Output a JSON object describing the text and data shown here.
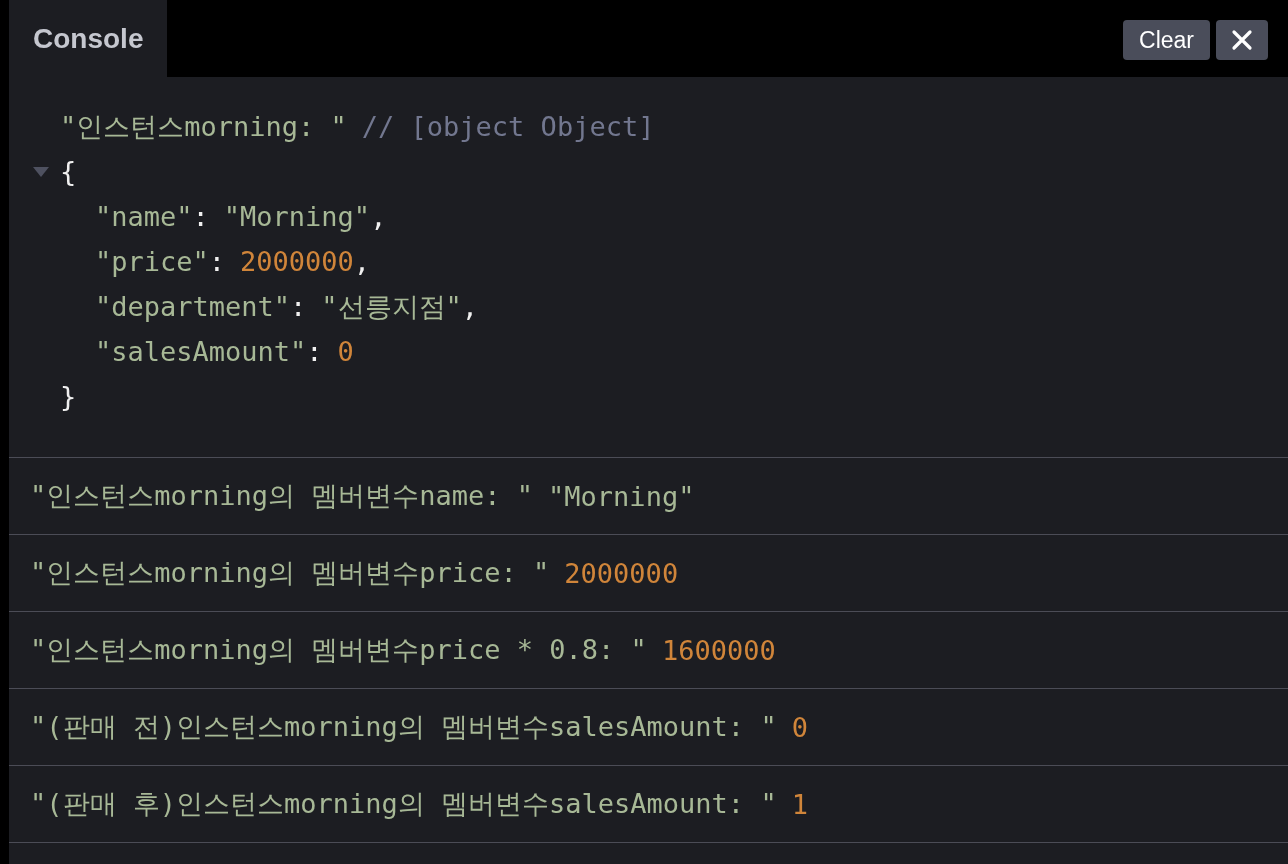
{
  "tabs": [
    {
      "label": "Console",
      "selected": true
    }
  ],
  "toolbar": {
    "clear_button": "Clear"
  },
  "entries": [
    {
      "kind": "object",
      "label": "\"인스턴스morning: \"",
      "comment": "// [object Object]",
      "expanded": true,
      "open_brace": "{",
      "close_brace": "}",
      "props": [
        {
          "key": "\"name\"",
          "colon": ":",
          "value": "\"Morning\"",
          "kind": "string",
          "comma": ","
        },
        {
          "key": "\"price\"",
          "colon": ":",
          "value": "2000000",
          "kind": "number",
          "comma": ","
        },
        {
          "key": "\"department\"",
          "colon": ":",
          "value": "\"선릉지점\"",
          "kind": "string",
          "comma": ","
        },
        {
          "key": "\"salesAmount\"",
          "colon": ":",
          "value": "0",
          "kind": "number"
        }
      ]
    },
    {
      "kind": "log",
      "parts": [
        {
          "text": "\"인스턴스morning의 멤버변수name: \"",
          "kind": "string"
        },
        {
          "text": "\"Morning\"",
          "kind": "string"
        }
      ]
    },
    {
      "kind": "log",
      "parts": [
        {
          "text": "\"인스턴스morning의 멤버변수price: \"",
          "kind": "string"
        },
        {
          "text": "2000000",
          "kind": "number"
        }
      ]
    },
    {
      "kind": "log",
      "parts": [
        {
          "text": "\"인스턴스morning의 멤버변수price * 0.8: \"",
          "kind": "string"
        },
        {
          "text": "1600000",
          "kind": "number"
        }
      ]
    },
    {
      "kind": "log",
      "parts": [
        {
          "text": "\"(판매 전)인스턴스morning의 멤버변수salesAmount: \"",
          "kind": "string"
        },
        {
          "text": "0",
          "kind": "number"
        }
      ]
    },
    {
      "kind": "log",
      "parts": [
        {
          "text": "\"(판매 후)인스턴스morning의 멤버변수salesAmount: \"",
          "kind": "string"
        },
        {
          "text": "1",
          "kind": "number"
        }
      ]
    }
  ]
}
